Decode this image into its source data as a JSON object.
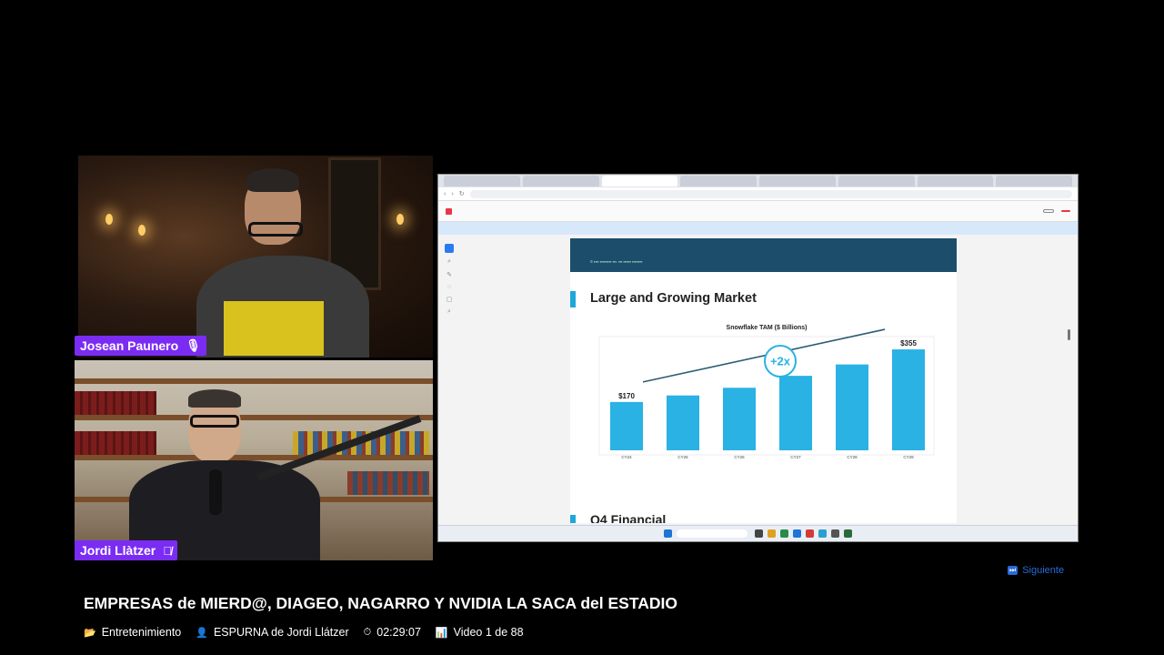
{
  "participants": [
    {
      "name": "Josean Paunero",
      "icon": "microphone-icon"
    },
    {
      "name": "Jordi Llàtzer",
      "icon": "muted-microphone-icon"
    }
  ],
  "screen_share": {
    "slide_title": "Large and Growing Market",
    "next_slide_title": "Q4 Financial",
    "chart_data": {
      "type": "bar",
      "title": "Snowflake TAM ($ Billions)",
      "categories": [
        "CY24",
        "CY25",
        "CY26",
        "CY27",
        "CY28",
        "CY29"
      ],
      "values": [
        170,
        193,
        220,
        262,
        302,
        355
      ],
      "data_labels": [
        "$170",
        "",
        "",
        "",
        "",
        "$355"
      ],
      "annotation": "+2x",
      "ylim": [
        0,
        400
      ],
      "color": "#29b2e3"
    }
  },
  "next_button": {
    "label": "Siguiente",
    "icon": "skip-forward-icon"
  },
  "video": {
    "title": "EMPRESAS de MIERD@, DIAGEO, NAGARRO Y NVIDIA LA SACA del ESTADIO",
    "category": "Entretenimiento",
    "category_icon": "folder-icon",
    "channel": "ESPURNA de Jordi Llátzer",
    "channel_icon": "person-icon",
    "duration": "02:29:07",
    "duration_icon": "stopwatch-icon",
    "position": "Video 1 de 88",
    "position_icon": "bar-chart-icon"
  }
}
